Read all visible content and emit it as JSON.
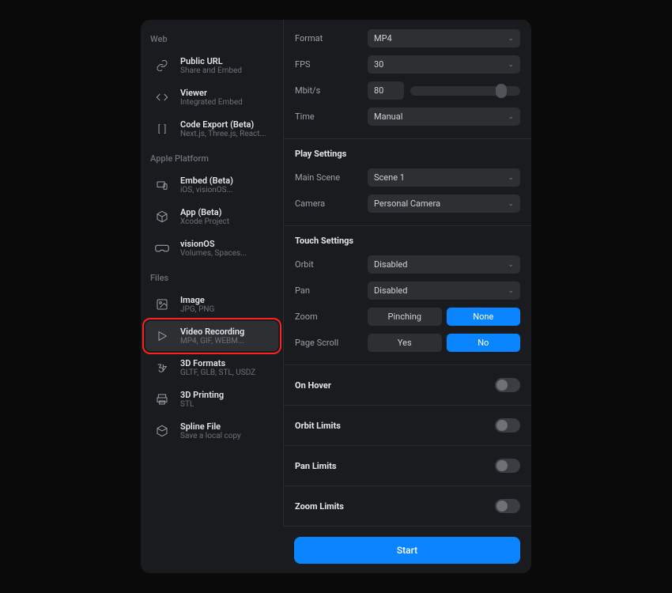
{
  "sidebar": {
    "sections": [
      {
        "header": "Web",
        "items": [
          {
            "title": "Public URL",
            "sub": "Share and Embed",
            "icon": "link-icon"
          },
          {
            "title": "Viewer",
            "sub": "Integrated Embed",
            "icon": "code-icon"
          },
          {
            "title": "Code Export (Beta)",
            "sub": "Next.js, Three.js, React...",
            "icon": "brackets-icon"
          }
        ]
      },
      {
        "header": "Apple Platform",
        "items": [
          {
            "title": "Embed (Beta)",
            "sub": "iOS, visionOS...",
            "icon": "devices-icon"
          },
          {
            "title": "App (Beta)",
            "sub": "Xcode Project",
            "icon": "cube-icon"
          },
          {
            "title": "visionOS",
            "sub": "Volumes, Spaces...",
            "icon": "vision-icon"
          }
        ]
      },
      {
        "header": "Files",
        "items": [
          {
            "title": "Image",
            "sub": "JPG, PNG",
            "icon": "image-icon"
          },
          {
            "title": "Video Recording",
            "sub": "MP4, GIF, WEBM...",
            "icon": "play-icon",
            "selected": true
          },
          {
            "title": "3D Formats",
            "sub": "GLTF, GLB, STL, USDZ",
            "icon": "3d-icon"
          },
          {
            "title": "3D Printing",
            "sub": "STL",
            "icon": "print-icon"
          },
          {
            "title": "Spline File",
            "sub": "Save a local copy",
            "icon": "package-icon"
          }
        ]
      }
    ]
  },
  "settings": {
    "format": {
      "label": "Format",
      "value": "MP4"
    },
    "fps": {
      "label": "FPS",
      "value": "30"
    },
    "mbits": {
      "label": "Mbit/s",
      "value": "80"
    },
    "time": {
      "label": "Time",
      "value": "Manual"
    }
  },
  "playSettings": {
    "title": "Play Settings",
    "mainScene": {
      "label": "Main Scene",
      "value": "Scene 1"
    },
    "camera": {
      "label": "Camera",
      "value": "Personal Camera"
    }
  },
  "touchSettings": {
    "title": "Touch Settings",
    "orbit": {
      "label": "Orbit",
      "value": "Disabled"
    },
    "pan": {
      "label": "Pan",
      "value": "Disabled"
    },
    "zoom": {
      "label": "Zoom",
      "options": [
        "Pinching",
        "None"
      ],
      "active": 1
    },
    "pageScroll": {
      "label": "Page Scroll",
      "options": [
        "Yes",
        "No"
      ],
      "active": 1
    }
  },
  "toggles": {
    "onHover": {
      "label": "On Hover",
      "value": false
    },
    "orbitLimits": {
      "label": "Orbit Limits",
      "value": false
    },
    "panLimits": {
      "label": "Pan Limits",
      "value": false
    },
    "zoomLimits": {
      "label": "Zoom Limits",
      "value": false
    }
  },
  "footer": {
    "start": "Start"
  }
}
